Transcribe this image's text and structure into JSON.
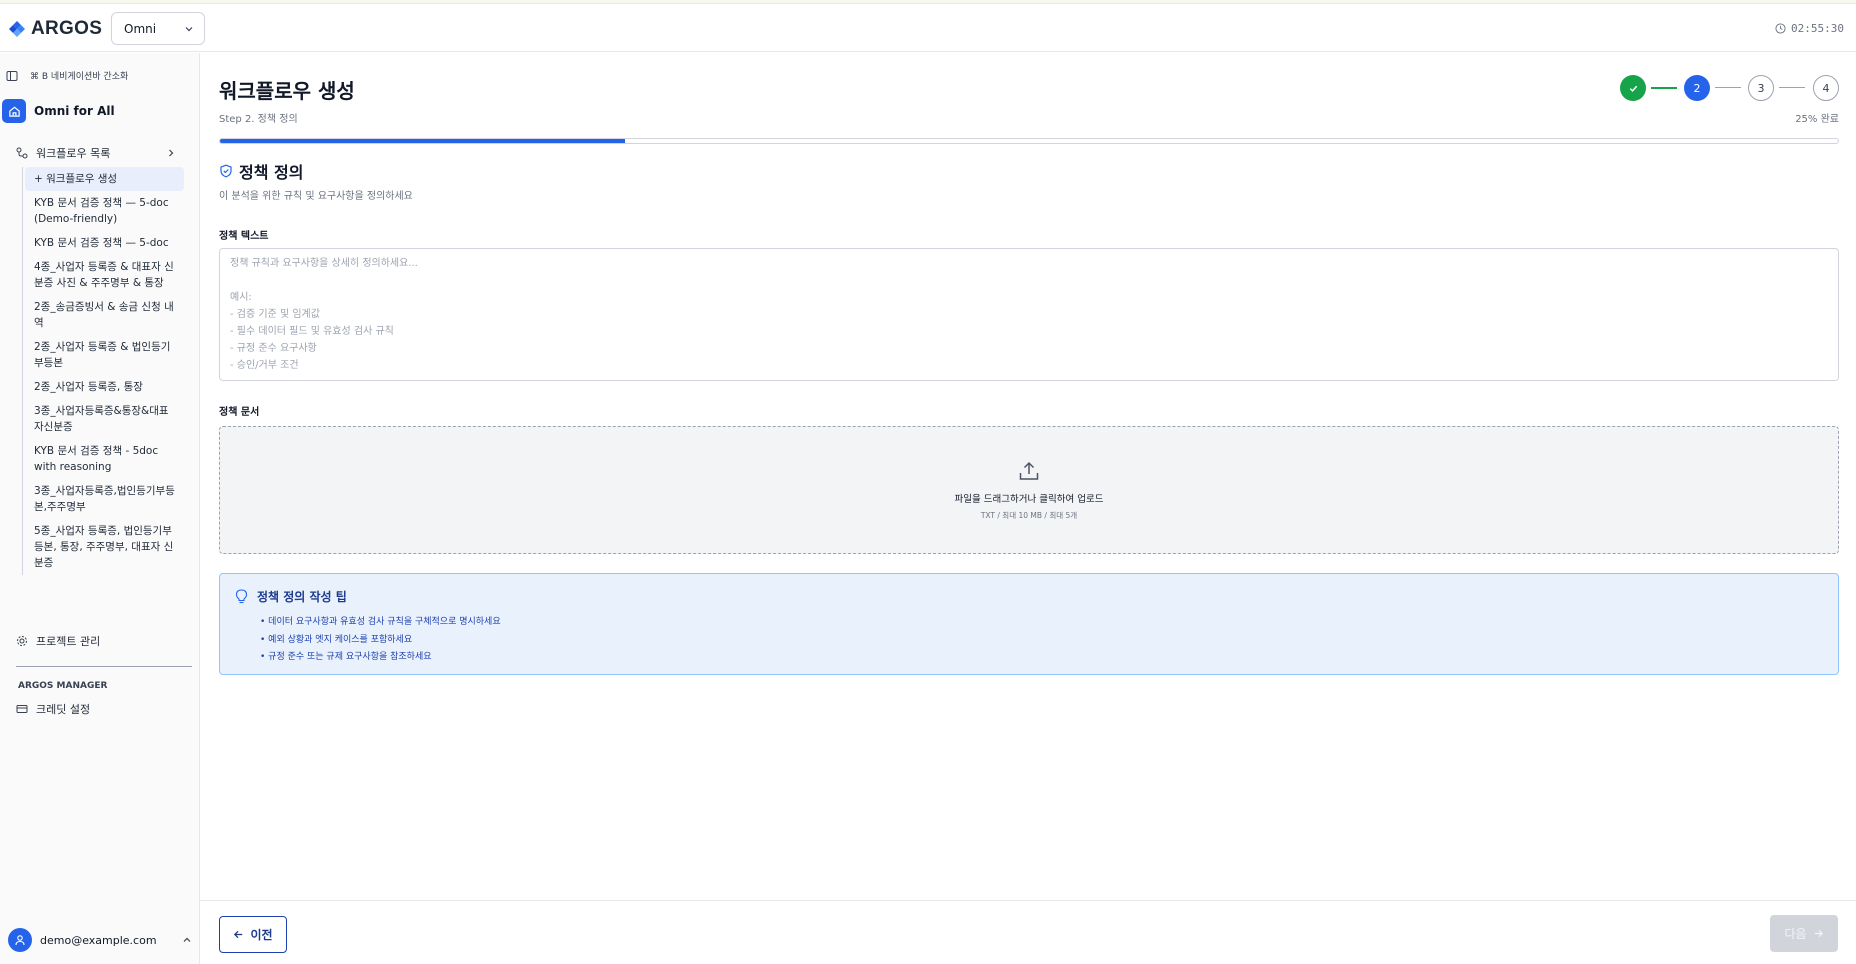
{
  "app": {
    "logo_text": "ARGOS",
    "workspace": "Omni",
    "clock": "02:55:30"
  },
  "sidebar": {
    "shortcut_hint": "⌘ B 네비게이션바 간소화",
    "project_name": "Omni for All",
    "workflow_group_label": "워크플로우 목록",
    "workflows": [
      "+ 워크플로우 생성",
      "KYB 문서 검증 정책 — 5-doc (Demo-friendly)",
      "KYB 문서 검증 정책 — 5-doc",
      "4종_사업자 등록증 & 대표자 신분증 사진 & 주주명부 & 통장",
      "2종_송금증빙서 & 송금 신청 내역",
      "2종_사업자 등록증 & 법인등기부등본",
      "2종_사업자 등록증, 통장",
      "3종_사업자등록증&통장&대표자신분증",
      "KYB 문서 검증 정책 - 5doc with reasoning",
      "3종_사업자등록증,법인등기부등본,주주명부",
      "5종_사업자 등록증, 법인등기부등본, 통장, 주주명부, 대표자 신분증"
    ],
    "project_manage_label": "프로젝트 관리",
    "manager_section_label": "ARGOS MANAGER",
    "credit_label": "크레딧 설정",
    "user_email": "demo@example.com"
  },
  "main": {
    "title": "워크플로우 생성",
    "subtitle": "Step 2. 정책 정의",
    "steps": [
      "✓",
      "2",
      "3",
      "4"
    ],
    "current_step": 2,
    "progress_text": "25% 완료",
    "progress_fraction": 0.25,
    "section_title": "정책 정의",
    "section_desc": "이 분석을 위한 규칙 및 요구사항을 정의하세요",
    "policy_text_label": "정책 텍스트",
    "policy_text_value": "",
    "policy_text_placeholder": "정책 규칙과 요구사항을 상세히 정의하세요...\n\n예시:\n- 검증 기준 및 임계값\n- 필수 데이터 필드 및 유효성 검사 규칙\n- 규정 준수 요구사항\n- 승인/거부 조건",
    "policy_doc_label": "정책 문서",
    "upload_text": "파일을 드래그하거나 클릭하여 업로드",
    "upload_hint": "TXT / 최대 10 MB / 최대 5개",
    "tips_title": "정책 정의 작성 팁",
    "tips": [
      "• 데이터 요구사항과 유효성 검사 규칙을 구체적으로 명시하세요",
      "• 예외 상황과 엣지 케이스를 포함하세요",
      "• 규정 준수 또는 규제 요구사항을 참조하세요"
    ]
  },
  "footer": {
    "prev_label": "이전",
    "next_label": "다음"
  },
  "colors": {
    "accent": "#2563eb",
    "success": "#16a34a",
    "tip_bg": "#e8f1fc"
  }
}
